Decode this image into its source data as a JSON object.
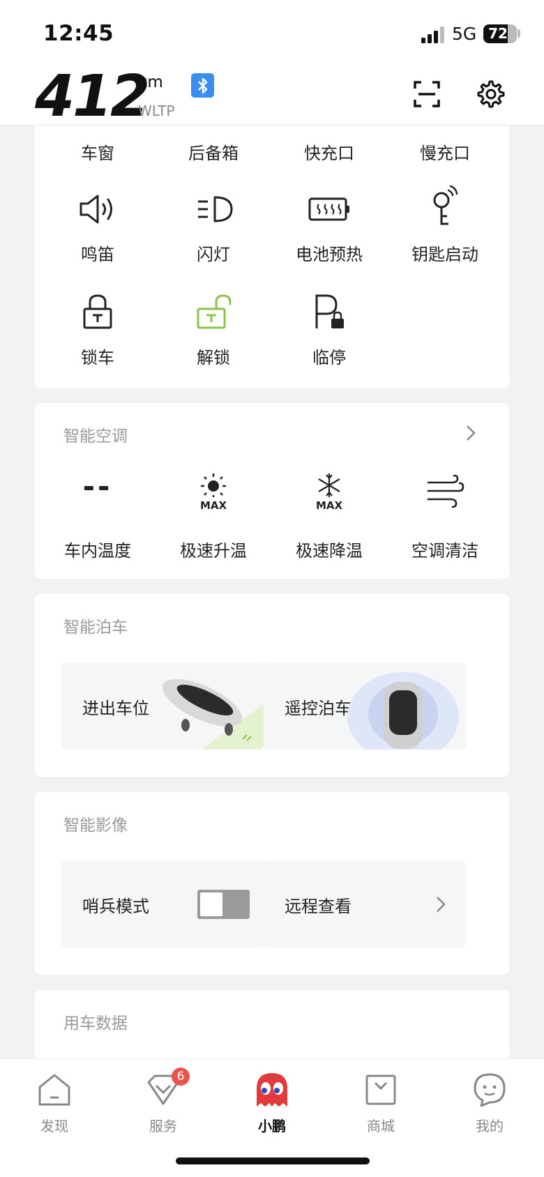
{
  "status_bar": {
    "time": "12:45",
    "network": "5G",
    "battery": "72",
    "battery_level": 0.72
  },
  "header": {
    "range_value": "412",
    "range_unit": "km",
    "range_standard": "WLTP",
    "icons": [
      "bluetooth-icon",
      "scan-icon",
      "gear-icon"
    ]
  },
  "controls": {
    "row1": [
      "车窗",
      "后备箱",
      "快充口",
      "慢充口"
    ],
    "row2": [
      {
        "label": "鸣笛",
        "icon": "horn-icon"
      },
      {
        "label": "闪灯",
        "icon": "headlight-icon"
      },
      {
        "label": "电池预热",
        "icon": "battery-heat-icon"
      },
      {
        "label": "钥匙启动",
        "icon": "key-start-icon"
      }
    ],
    "row3": [
      {
        "label": "锁车",
        "icon": "lock-icon"
      },
      {
        "label": "解锁",
        "icon": "unlock-icon"
      },
      {
        "label": "临停",
        "icon": "temp-parking-icon"
      }
    ]
  },
  "climate": {
    "title": "智能空调",
    "items": [
      {
        "label": "车内温度",
        "value": "--",
        "icon": "temperature-icon"
      },
      {
        "label": "极速升温",
        "icon": "max-heat-icon",
        "icon_text": "MAX"
      },
      {
        "label": "极速降温",
        "icon": "max-cool-icon",
        "icon_text": "MAX"
      },
      {
        "label": "空调清洁",
        "icon": "ac-clean-icon"
      }
    ]
  },
  "parking": {
    "title": "智能泊车",
    "tiles": [
      "进出车位",
      "遥控泊车"
    ]
  },
  "camera": {
    "title": "智能影像",
    "sentry_label": "哨兵模式",
    "sentry_on": false,
    "remote_label": "远程查看"
  },
  "data_section": {
    "title": "用车数据"
  },
  "nav": {
    "items": [
      {
        "label": "发现",
        "icon": "home-icon"
      },
      {
        "label": "服务",
        "icon": "service-icon",
        "badge": "6"
      },
      {
        "label": "小鹏",
        "icon": "xpeng-mascot-icon",
        "active": true
      },
      {
        "label": "商城",
        "icon": "store-icon"
      },
      {
        "label": "我的",
        "icon": "profile-icon"
      }
    ]
  },
  "colors": {
    "accent_green": "#8bc34a",
    "bluetooth_blue": "#3b8ef0",
    "badge_red": "#e8534b",
    "mascot_red": "#e23a3a"
  }
}
